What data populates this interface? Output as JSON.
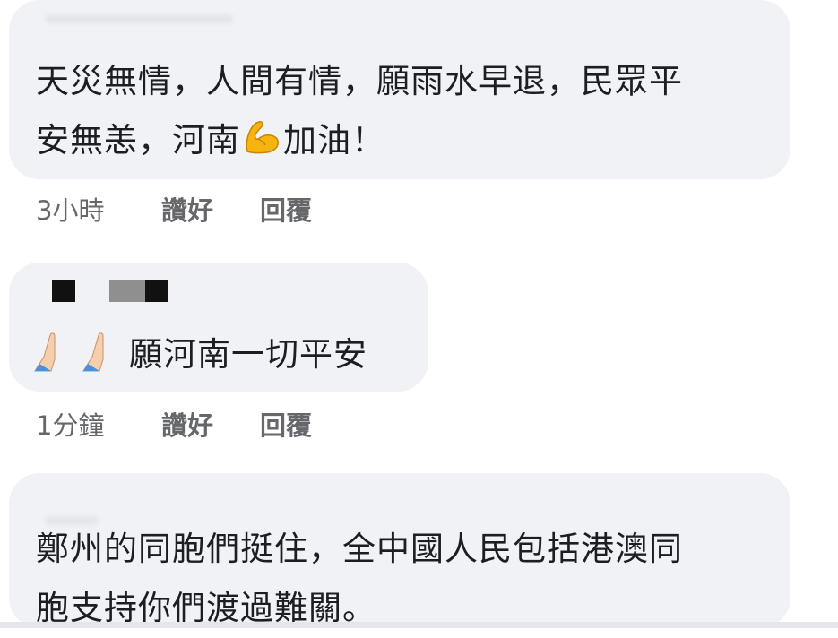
{
  "comments": [
    {
      "author": "",
      "text_line1": "天災無情，人間有情，願雨水早退，民眾平",
      "text_line2_before": "安無恙，河南",
      "emoji": "flexed-biceps",
      "text_line2_after": "加油！",
      "time": "3小時",
      "like": "讚好",
      "reply": "回覆"
    },
    {
      "author": "",
      "emoji": "folded-hands",
      "text": "願河南一切平安",
      "time": "1分鐘",
      "like": "讚好",
      "reply": "回覆"
    },
    {
      "author": "",
      "text_line1": "鄭州的同胞們挺住，全中國人民包括港澳同",
      "text_line2": "胞支持你們渡過難關。"
    }
  ],
  "colors": {
    "bubble": "#f0f2f5",
    "text": "#1c1e21",
    "meta": "#65676b"
  }
}
